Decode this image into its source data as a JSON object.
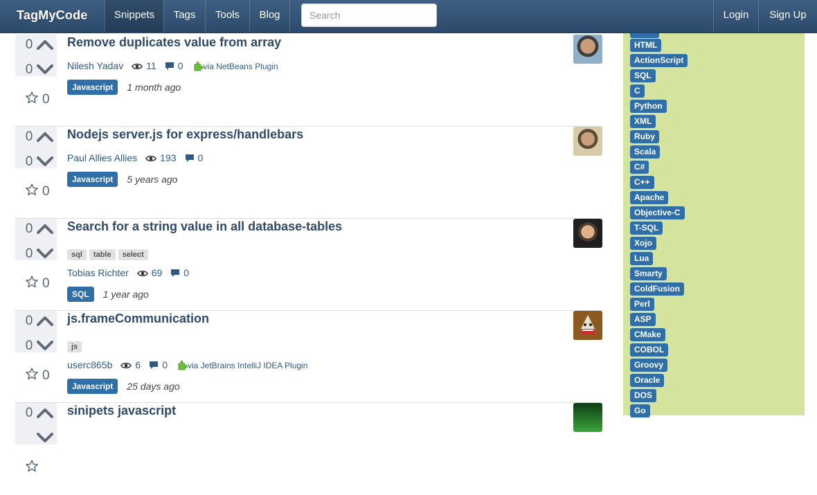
{
  "nav": {
    "brand": "TagMyCode",
    "items": [
      "Snippets",
      "Tags",
      "Tools",
      "Blog"
    ],
    "search_placeholder": "Search",
    "login": "Login",
    "signup": "Sign Up"
  },
  "snippets": [
    {
      "title": "Remove duplicates value from array",
      "tags": [],
      "author": "Nilesh Yadav",
      "views": "11",
      "comments": "0",
      "plugin": "via NetBeans Plugin",
      "language": "Javascript",
      "age": "1 month ago",
      "votes_up": "0",
      "votes_down": "0",
      "stars": "0"
    },
    {
      "title": "Nodejs server.js for express/handlebars",
      "tags": [],
      "author": "Paul Allies Allies",
      "views": "193",
      "comments": "0",
      "plugin": "",
      "language": "Javascript",
      "age": "5 years ago",
      "votes_up": "0",
      "votes_down": "0",
      "stars": "0"
    },
    {
      "title": "Search for a string value in all database-tables",
      "tags": [
        "sql",
        "table",
        "select"
      ],
      "author": "Tobias Richter",
      "views": "69",
      "comments": "0",
      "plugin": "",
      "language": "SQL",
      "age": "1 year ago",
      "votes_up": "0",
      "votes_down": "0",
      "stars": "0"
    },
    {
      "title": "js.frameCommunication",
      "tags": [
        "js"
      ],
      "author": "userc865b",
      "views": "6",
      "comments": "0",
      "plugin": "via JetBrains IntelliJ IDEA Plugin",
      "language": "Javascript",
      "age": "25 days ago",
      "votes_up": "0",
      "votes_down": "0",
      "stars": "0"
    },
    {
      "title": "sinipets javascript",
      "tags": [],
      "author": "",
      "views": "",
      "comments": "",
      "plugin": "",
      "language": "",
      "age": "",
      "votes_up": "0",
      "votes_down": "",
      "stars": ""
    }
  ],
  "sidebar_languages": [
    "HTML",
    "ActionScript",
    "SQL",
    "C",
    "Python",
    "XML",
    "Ruby",
    "Scala",
    "C#",
    "C++",
    "Apache",
    "Objective-C",
    "T-SQL",
    "Xojo",
    "Lua",
    "Smarty",
    "ColdFusion",
    "Perl",
    "ASP",
    "CMake",
    "COBOL",
    "Groovy",
    "Oracle",
    "DOS",
    "Go"
  ],
  "colors": {
    "navbar": "#34557a",
    "link": "#2e4a68",
    "language_badge": "#2f6ea7",
    "sidebar_bg": "#d4e49e"
  }
}
